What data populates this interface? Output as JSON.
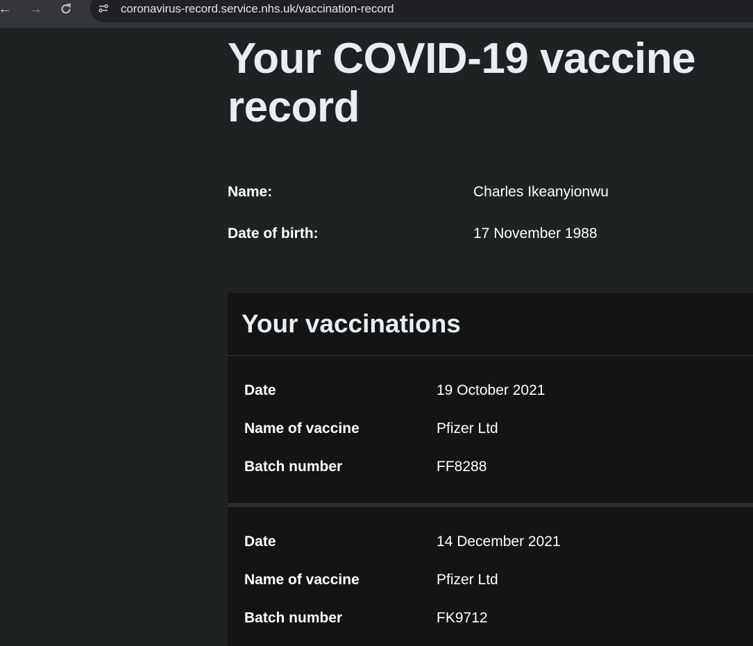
{
  "browser": {
    "url": "coronavirus-record.service.nhs.uk/vaccination-record",
    "icons": {
      "back": "arrow-left-icon",
      "forward": "arrow-right-icon",
      "reload": "reload-icon",
      "site_info": "site-settings-icon"
    }
  },
  "page": {
    "title": "Your COVID-19 vaccine record",
    "details": {
      "name_label": "Name:",
      "name_value": "Charles Ikeanyionwu",
      "dob_label": "Date of birth:",
      "dob_value": "17 November 1988"
    }
  },
  "vaccinations": {
    "heading": "Your vaccinations",
    "doses": [
      {
        "date_label": "Date",
        "date_value": "19 October 2021",
        "vaccine_label": "Name of vaccine",
        "vaccine_value": "Pfizer Ltd",
        "batch_label": "Batch number",
        "batch_value": "FF8288"
      },
      {
        "date_label": "Date",
        "date_value": "14 December 2021",
        "vaccine_label": "Name of vaccine",
        "vaccine_value": "Pfizer Ltd",
        "batch_label": "Batch number",
        "batch_value": "FK9712"
      }
    ]
  },
  "colors": {
    "page_background": "#1f2223",
    "panel_background": "#141414",
    "heading_text": "#e8eef2",
    "body_text": "#ffffff"
  }
}
